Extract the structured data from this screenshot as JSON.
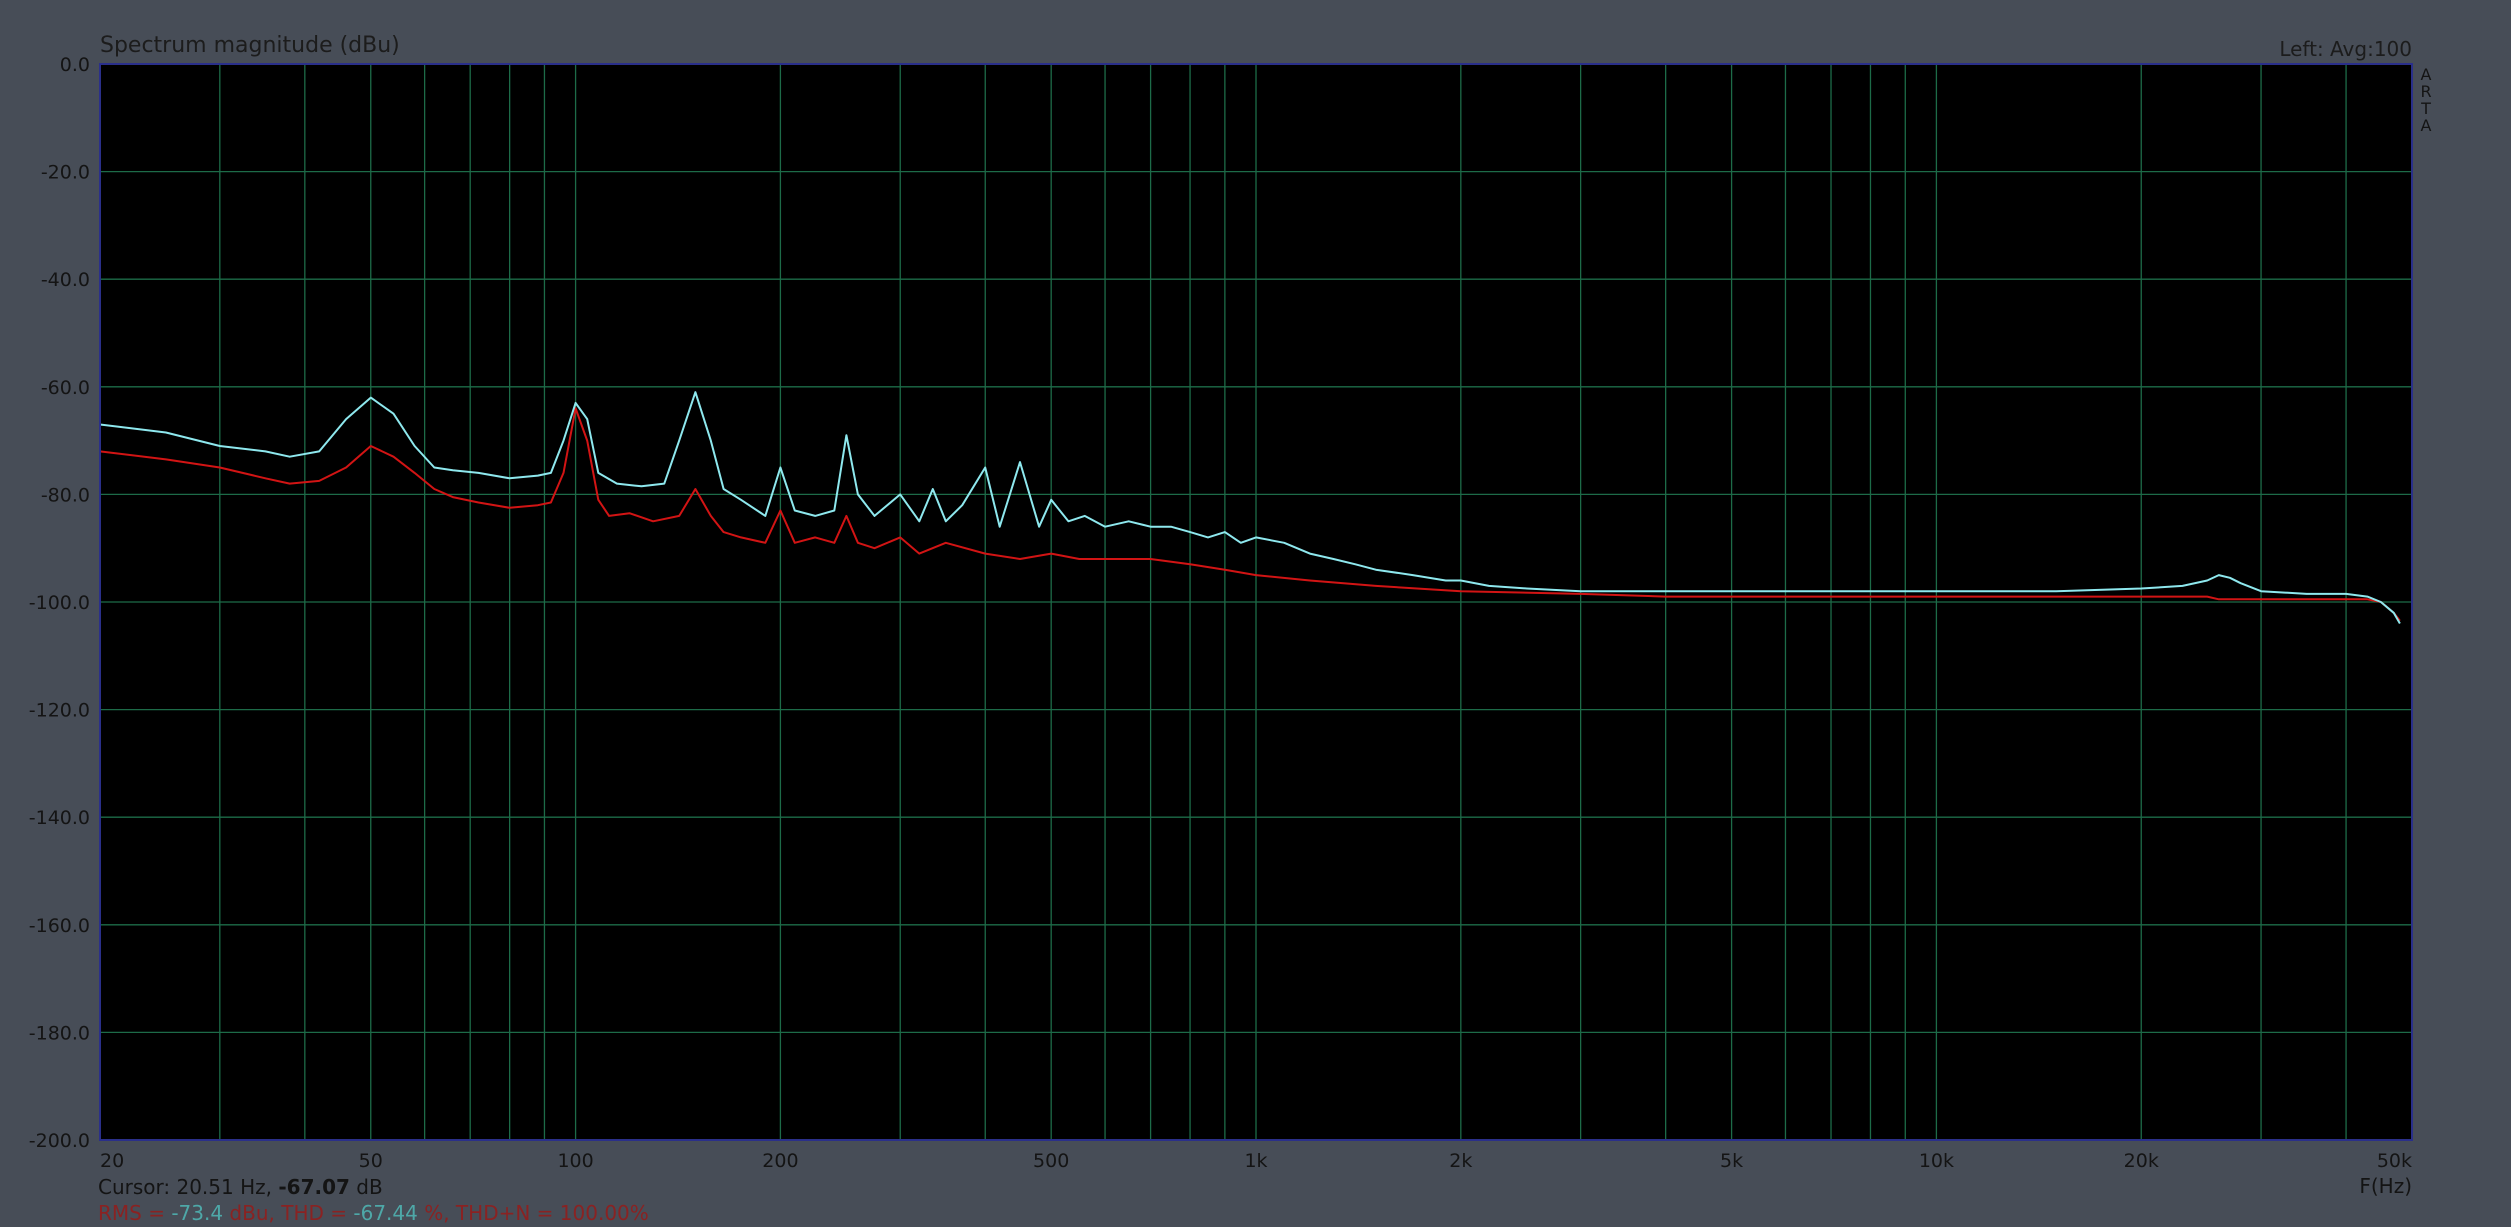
{
  "window": {
    "title": "Spectrum magnitude (dBu)",
    "top_right": "Left: Avg:100",
    "brand": [
      "A",
      "R",
      "T",
      "A"
    ]
  },
  "footer": {
    "cursor_prefix": "Cursor: 20.51 Hz, ",
    "cursor_value": "-67.07",
    "cursor_unit": " dB",
    "rms_line_prefix": "RMS = ",
    "rms_value": "-73.4",
    "rms_mid": " dBu, THD = ",
    "thd_value": "-67.44",
    "rms_line_suffix": " %, THD+N = 100.00%"
  },
  "colors": {
    "frame": "#474d57",
    "plot_bg": "#000000",
    "grid": "#1d6b48",
    "axis_text": "#141414",
    "title_text": "#1c1c1c",
    "plot_border": "#2a2f8a",
    "series_cyan": "#8ee8ee",
    "series_red": "#d21414",
    "footer_red": "#8a2222",
    "footer_highlight": "#4ea8a8"
  },
  "chart_data": {
    "type": "line",
    "title": "Spectrum magnitude (dBu)",
    "xlabel": "F(Hz)",
    "ylabel": "",
    "x_scale": "log",
    "xlim": [
      20,
      50000
    ],
    "ylim": [
      -200,
      0
    ],
    "grid": true,
    "x_ticks": [
      20,
      50,
      100,
      200,
      500,
      1000,
      2000,
      5000,
      10000,
      20000,
      50000
    ],
    "x_tick_labels": [
      "20",
      "50",
      "100",
      "200",
      "500",
      "1k",
      "2k",
      "5k",
      "10k",
      "20k",
      "50k"
    ],
    "y_ticks": [
      0,
      -20,
      -40,
      -60,
      -80,
      -100,
      -120,
      -140,
      -160,
      -180,
      -200
    ],
    "y_tick_labels": [
      "0.0",
      "-20.0",
      "-40.0",
      "-60.0",
      "-80.0",
      "-100.0",
      "-120.0",
      "-140.0",
      "-160.0",
      "-180.0",
      "-200.0"
    ],
    "series": [
      {
        "color": "#8ee8ee",
        "x": [
          20,
          25,
          30,
          35,
          38,
          42,
          46,
          50,
          54,
          58,
          62,
          66,
          72,
          80,
          88,
          92,
          96,
          100,
          104,
          108,
          115,
          125,
          135,
          142,
          150,
          158,
          165,
          175,
          190,
          200,
          210,
          225,
          240,
          250,
          260,
          275,
          300,
          320,
          335,
          350,
          370,
          400,
          420,
          450,
          480,
          500,
          530,
          560,
          600,
          650,
          700,
          750,
          800,
          850,
          900,
          950,
          1000,
          1100,
          1200,
          1300,
          1400,
          1500,
          1700,
          1900,
          2000,
          2200,
          2500,
          3000,
          4000,
          5000,
          7000,
          10000,
          15000,
          20000,
          23000,
          25000,
          26000,
          27000,
          28000,
          30000,
          35000,
          40000,
          43000,
          45000,
          47000,
          48000
        ],
        "y": [
          -67,
          -68.5,
          -71,
          -72,
          -73,
          -72,
          -66,
          -62,
          -65,
          -71,
          -75,
          -75.5,
          -76,
          -77,
          -76.5,
          -76,
          -70,
          -63,
          -66,
          -76,
          -78,
          -78.5,
          -78,
          -70,
          -61,
          -70,
          -79,
          -81,
          -84,
          -75,
          -83,
          -84,
          -83,
          -69,
          -80,
          -84,
          -80,
          -85,
          -79,
          -85,
          -82,
          -75,
          -86,
          -74,
          -86,
          -81,
          -85,
          -84,
          -86,
          -85,
          -86,
          -86,
          -87,
          -88,
          -87,
          -89,
          -88,
          -89,
          -91,
          -92,
          -93,
          -94,
          -95,
          -96,
          -96,
          -97,
          -97.5,
          -98,
          -98,
          -98,
          -98,
          -98,
          -98,
          -97.5,
          -97,
          -96,
          -95,
          -95.5,
          -96.5,
          -98,
          -98.5,
          -98.5,
          -99,
          -100,
          -102,
          -104
        ]
      },
      {
        "color": "#d21414",
        "x": [
          20,
          25,
          30,
          35,
          38,
          42,
          46,
          50,
          54,
          58,
          62,
          66,
          72,
          80,
          88,
          92,
          96,
          100,
          104,
          108,
          112,
          120,
          130,
          142,
          150,
          158,
          165,
          175,
          190,
          200,
          210,
          225,
          240,
          250,
          260,
          275,
          300,
          320,
          350,
          400,
          450,
          500,
          550,
          600,
          700,
          800,
          900,
          1000,
          1200,
          1500,
          2000,
          3000,
          4000,
          5000,
          7000,
          10000,
          15000,
          20000,
          25000,
          26000,
          28000,
          30000,
          35000,
          40000,
          43000,
          45000,
          47000,
          48000
        ],
        "y": [
          -72,
          -73.5,
          -75,
          -77,
          -78,
          -77.5,
          -75,
          -71,
          -73,
          -76,
          -79,
          -80.5,
          -81.5,
          -82.5,
          -82,
          -81.5,
          -76,
          -64,
          -70,
          -81,
          -84,
          -83.5,
          -85,
          -84,
          -79,
          -84,
          -87,
          -88,
          -89,
          -83,
          -89,
          -88,
          -89,
          -84,
          -89,
          -90,
          -88,
          -91,
          -89,
          -91,
          -92,
          -91,
          -92,
          -92,
          -92,
          -93,
          -94,
          -95,
          -96,
          -97,
          -98,
          -98.5,
          -99,
          -99,
          -99,
          -99,
          -99,
          -99,
          -99,
          -99.5,
          -99.5,
          -99.5,
          -99.5,
          -99.5,
          -99.5,
          -100,
          -102,
          -103.5
        ]
      }
    ],
    "annotations": [
      "Left: Avg:100"
    ]
  }
}
